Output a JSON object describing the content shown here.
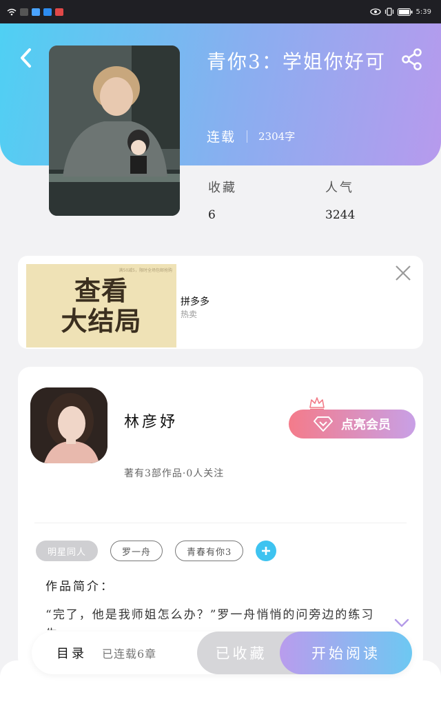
{
  "status_bar": {
    "carrier_icons": [
      "wifi-icon",
      "hd-icon",
      "app-icon-blue",
      "app-icon-globe",
      "app-icon-red"
    ],
    "time": "5:39"
  },
  "book": {
    "title": "青你3：学姐你好可",
    "status": "连载",
    "word_count": "2304字",
    "favorites_label": "收藏",
    "favorites_value": "6",
    "popularity_label": "人气",
    "popularity_value": "3244"
  },
  "ad": {
    "image_fine_print": "满50减5，限时全场包邮抢购",
    "headline_line1": "查看",
    "headline_line2": "大结局",
    "brand": "拼多多",
    "tag": "热卖"
  },
  "author": {
    "name": "林彦妤",
    "stats": "著有3部作品·0人关注",
    "vip_label": "点亮会员"
  },
  "tags": [
    "明星同人",
    "罗一舟",
    "青春有你3"
  ],
  "intro": {
    "label": "作品简介：",
    "text": "“完了，他是我师姐怎么办？”罗一舟悄悄的问旁边的练习生"
  },
  "actions": {
    "toc_label": "目录",
    "toc_status": "已连载6章",
    "collected_label": "已收藏",
    "read_label": "开始阅读"
  },
  "colors": {
    "hero_gradient_start": "#4fd0f3",
    "hero_gradient_end": "#b79aed",
    "accent_blue": "#3ec3f0",
    "vip_pink": "#f47b8a"
  }
}
